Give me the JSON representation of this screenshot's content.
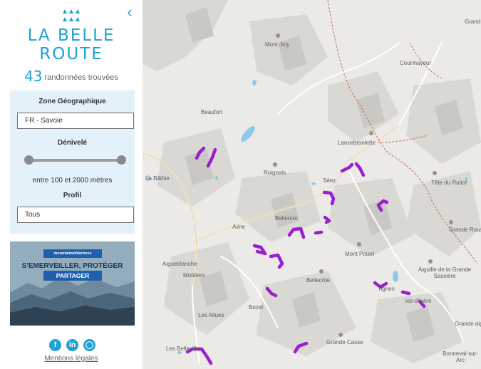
{
  "sidebar": {
    "brand_line1": "LA BELLE",
    "brand_line2": "ROUTE",
    "back_icon": "chevron-left-icon",
    "result_count": "43",
    "result_label": "randonnées trouvées",
    "filters": {
      "zone_label": "Zone Géographique",
      "zone_value": "FR - Savoie",
      "denivele_label": "Dénivelé",
      "denivele_min": 100,
      "denivele_max": 2000,
      "denivele_text": "entre 100 et 2000 mètres",
      "profil_label": "Profil",
      "profil_value": "Tous"
    },
    "promo": {
      "badge": "mountainwilderness",
      "line1": "S'EMERVEILLER, PROTÉGER",
      "line2": "PARTAGER"
    },
    "social": [
      "facebook-icon",
      "linkedin-icon",
      "instagram-icon"
    ],
    "legal_link": "Mentions légales"
  },
  "colors": {
    "accent": "#1ea2d7",
    "route": "#9a1fd1",
    "filter_bg": "#e3f1fa"
  },
  "map": {
    "places": [
      {
        "id": "mont-joly",
        "name": "Mont Joly",
        "peak": true
      },
      {
        "id": "grand",
        "name": "Grand",
        "peak": false
      },
      {
        "id": "courmayeur",
        "name": "Courmayeur",
        "peak": false
      },
      {
        "id": "beaufort",
        "name": "Beaufort",
        "peak": false
      },
      {
        "id": "lancebranlette",
        "name": "Lancebranlette",
        "peak": true
      },
      {
        "id": "roignais",
        "name": "Roignais",
        "peak": true
      },
      {
        "id": "seez",
        "name": "Séez",
        "peak": false
      },
      {
        "id": "tete-du-ruitor",
        "name": "Tête du Ruitor",
        "peak": true
      },
      {
        "id": "la-bathie",
        "name": "La Bâthie",
        "peak": false
      },
      {
        "id": "bellentre",
        "name": "Bellentre",
        "peak": false
      },
      {
        "id": "aime",
        "name": "Aime",
        "peak": false
      },
      {
        "id": "grande-rousse",
        "name": "Grande Rousse",
        "peak": true
      },
      {
        "id": "mont-pourri",
        "name": "Mont Pourri",
        "peak": true
      },
      {
        "id": "aigueblanche",
        "name": "Aigueblanche",
        "peak": false
      },
      {
        "id": "moutiers",
        "name": "Moûtiers",
        "peak": false
      },
      {
        "id": "bellecote",
        "name": "Bellecôte",
        "peak": true
      },
      {
        "id": "aiguille-grande-sassiere",
        "name": "Aiguille de la Grande Sassière",
        "peak": true
      },
      {
        "id": "tignes",
        "name": "Tignes",
        "peak": false
      },
      {
        "id": "val-disere",
        "name": "Val-d'Isère",
        "peak": false
      },
      {
        "id": "bozel",
        "name": "Bozel",
        "peak": false
      },
      {
        "id": "les-allues",
        "name": "Les Allues",
        "peak": false
      },
      {
        "id": "grande-casse",
        "name": "Grande Casse",
        "peak": true
      },
      {
        "id": "les-belleville",
        "name": "Les Belleville",
        "peak": false
      },
      {
        "id": "grande-aig",
        "name": "Grande aig",
        "peak": false
      },
      {
        "id": "bonneval",
        "name": "Bonneval-sur-Arc",
        "peak": false
      }
    ]
  }
}
